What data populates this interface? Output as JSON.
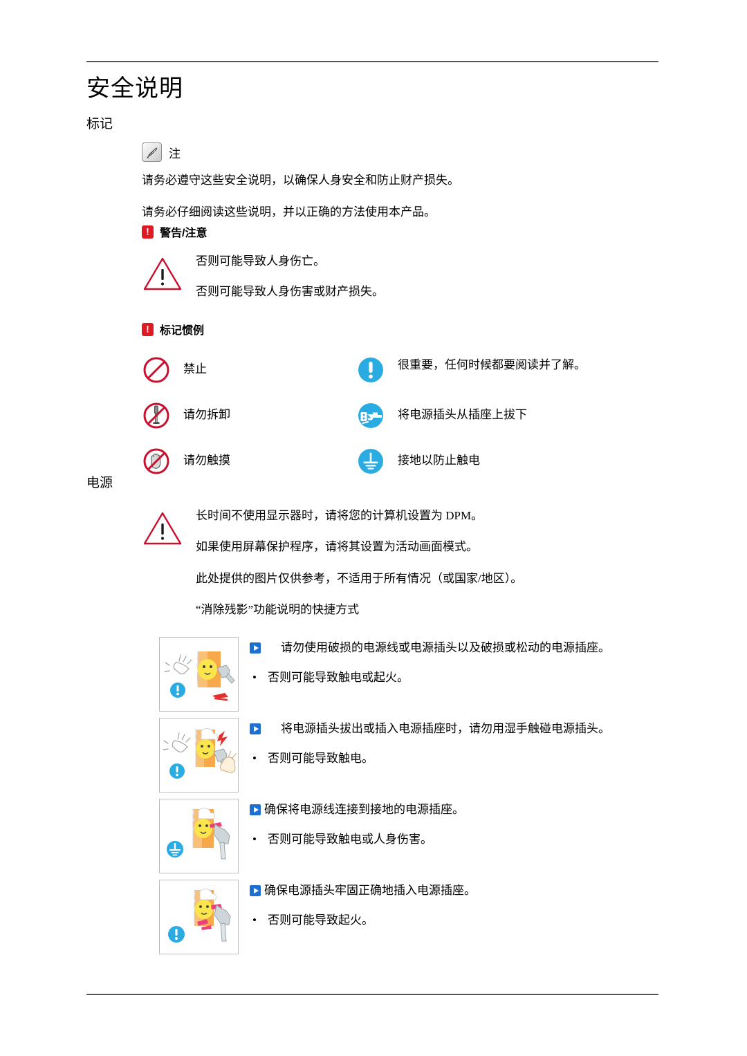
{
  "document": {
    "title": "安全说明"
  },
  "sections": {
    "marking": {
      "heading": "标记",
      "note": {
        "icon": "note-hand-icon",
        "label": "注",
        "paragraphs": [
          "请务必遵守这些安全说明，以确保人身安全和防止财产损失。",
          "请务必仔细阅读这些说明，并以正确的方法使用本产品。"
        ]
      },
      "warning_caution": {
        "icon": "red-exclamation-icon",
        "glyph": "!",
        "label": "警告/注意",
        "lines": [
          "否则可能导致人身伤亡。",
          "否则可能导致人身伤害或财产损失。"
        ]
      },
      "conventions": {
        "icon": "red-exclamation-icon",
        "glyph": "!",
        "label": "标记惯例",
        "items": [
          {
            "icon": "prohibition-icon",
            "label": "禁止"
          },
          {
            "icon": "important-read-icon",
            "label": "很重要，任何时候都要阅读并了解。"
          },
          {
            "icon": "no-disassembly-icon",
            "label": "请勿拆卸"
          },
          {
            "icon": "unplug-icon",
            "label": "将电源插头从插座上拔下"
          },
          {
            "icon": "do-not-touch-icon",
            "label": "请勿触摸"
          },
          {
            "icon": "ground-icon",
            "label": "接地以防止触电"
          }
        ]
      }
    },
    "power": {
      "heading": "电源",
      "warning": {
        "icon": "warning-triangle-icon",
        "lines": [
          "长时间不使用显示器时，请将您的计算机设置为 DPM。",
          "如果使用屏幕保护程序，请将其设置为活动画面模式。",
          "此处提供的图片仅供参考，不适用于所有情况（或国家/地区）。",
          "“消除残影”功能说明的快捷方式"
        ]
      },
      "rows": [
        {
          "thumb_icon": "damaged-plug-illustration",
          "badge": "important-read-icon",
          "lead": "请勿使用破损的电源线或电源插头以及破损或松动的电源插座。",
          "lead_indent": true,
          "bullet_marker": "•",
          "bullet": "否则可能导致触电或起火。"
        },
        {
          "thumb_icon": "wet-hand-plug-illustration",
          "badge": "important-read-icon",
          "lead": "将电源插头拔出或插入电源插座时，请勿用湿手触碰电源插头。",
          "lead_indent": true,
          "bullet_marker": "•",
          "bullet": "否则可能导致触电。"
        },
        {
          "thumb_icon": "grounded-outlet-illustration",
          "badge": "ground-icon",
          "lead": "确保将电源线连接到接地的电源插座。",
          "lead_indent": false,
          "bullet_marker": "•",
          "bullet": "否则可能导致触电或人身伤害。"
        },
        {
          "thumb_icon": "firm-plug-illustration",
          "badge": "important-read-icon",
          "lead": "确保电源插头牢固正确地插入电源插座。",
          "lead_indent": false,
          "bullet_marker": "•",
          "bullet": "否则可能导致起火。"
        }
      ]
    }
  },
  "colors": {
    "red": "#dd1b22",
    "prohibition_red": "#c8102e",
    "cyan": "#2aabe2",
    "blue_marker": "#1f6fd0",
    "rule": "#55575a"
  }
}
